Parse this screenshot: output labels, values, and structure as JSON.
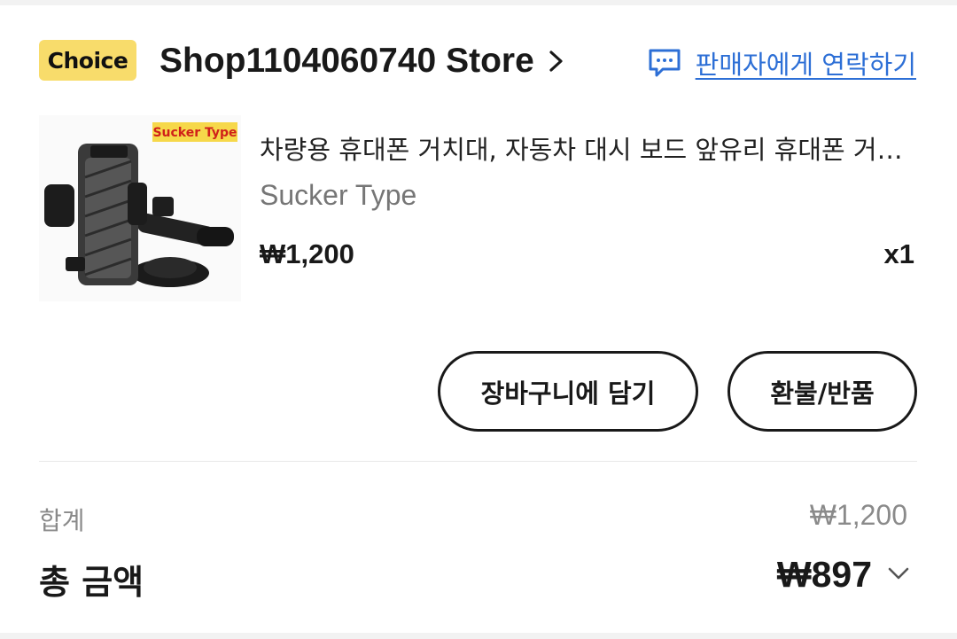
{
  "store": {
    "badge": "Choice",
    "name": "Shop1104060740 Store",
    "chevron_icon": "chevron-right-icon",
    "contact_label": "판매자에게 연락하기",
    "contact_icon": "chat-bubble-icon",
    "accent_color": "#2d6fd6",
    "badge_color": "#f8dc6b"
  },
  "product": {
    "image_label": "Sucker Type",
    "title": "차량용 휴대폰 거치대, 자동차 대시 보드 앞유리 휴대폰 거치대",
    "variant": "Sucker Type",
    "price": "₩1,200",
    "quantity": "x1"
  },
  "actions": {
    "add_to_cart": "장바구니에 담기",
    "refund_return": "환불/반품"
  },
  "summary": {
    "subtotal_label": "합계",
    "subtotal_value": "₩1,200",
    "total_label": "총 금액",
    "total_value": "₩897",
    "expand_icon": "chevron-down-icon"
  }
}
